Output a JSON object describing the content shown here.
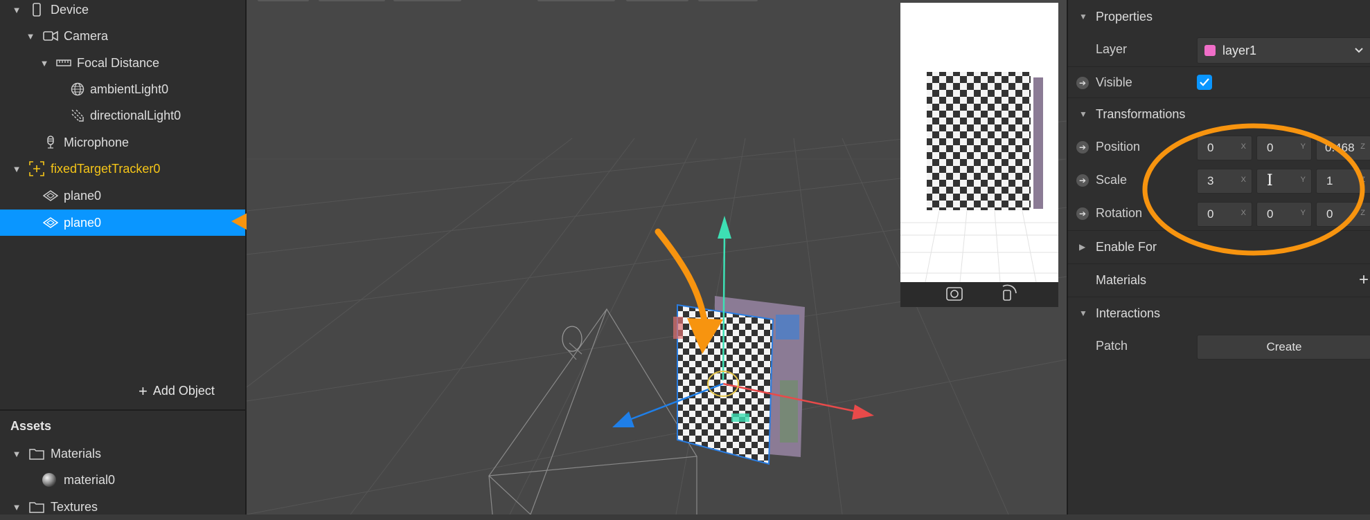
{
  "scene": {
    "items": [
      {
        "label": "Device",
        "icon": "phone-icon",
        "caret": "▼"
      },
      {
        "label": "Camera",
        "icon": "camera-icon",
        "caret": "▼"
      },
      {
        "label": "Focal Distance",
        "icon": "ruler-icon",
        "caret": "▼"
      },
      {
        "label": "ambientLight0",
        "icon": "globe-icon",
        "caret": ""
      },
      {
        "label": "directionalLight0",
        "icon": "directional-light-icon",
        "caret": ""
      },
      {
        "label": "Microphone",
        "icon": "microphone-icon",
        "caret": ""
      },
      {
        "label": "fixedTargetTracker0",
        "icon": "target-tracker-icon",
        "caret": "▼"
      },
      {
        "label": "plane0",
        "icon": "plane-icon",
        "caret": ""
      },
      {
        "label": "plane0",
        "icon": "plane-icon",
        "caret": ""
      }
    ],
    "add_object": "Add Object"
  },
  "assets": {
    "title": "Assets",
    "items": [
      {
        "label": "Materials",
        "icon": "folder-icon",
        "caret": "▼"
      },
      {
        "label": "material0",
        "icon": "sphere-icon",
        "caret": ""
      },
      {
        "label": "Textures",
        "icon": "folder-icon",
        "caret": "▼"
      }
    ]
  },
  "properties": {
    "sections": {
      "properties": "Properties",
      "transformations": "Transformations",
      "enable_for": "Enable For",
      "materials": "Materials",
      "interactions": "Interactions"
    },
    "layer_label": "Layer",
    "layer_value": "layer1",
    "layer_color": "#f06ec8",
    "visible_label": "Visible",
    "visible_checked": true,
    "position_label": "Position",
    "position": {
      "x": "0",
      "y": "0",
      "z": "0.468"
    },
    "scale_label": "Scale",
    "scale": {
      "x": "3",
      "y": "",
      "z": "1"
    },
    "rotation_label": "Rotation",
    "rotation": {
      "x": "0",
      "y": "0",
      "z": "0"
    },
    "axis": {
      "x": "X",
      "y": "Y",
      "z": "Z"
    },
    "patch_label": "Patch",
    "create_label": "Create"
  },
  "colors": {
    "selection": "#0a96ff",
    "tracker": "#f5c518",
    "annotation": "#f7940f",
    "gizmo_y": "#3de0b4",
    "gizmo_x": "#e84a4a",
    "gizmo_z": "#1f7fe8"
  }
}
